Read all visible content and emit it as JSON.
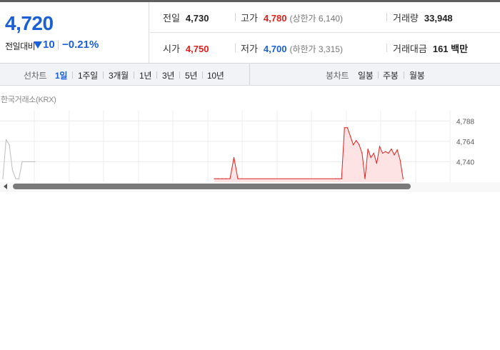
{
  "quote": {
    "price": "4,720",
    "change_label": "전일대비",
    "change_value": "10",
    "change_pct": "−0.21%",
    "direction": "down",
    "color_down": "#1a5fd6",
    "color_up": "#e0201d"
  },
  "stats": {
    "prev_close_label": "전일",
    "prev_close": "4,730",
    "high_label": "고가",
    "high": "4,780",
    "upper_limit": "(상한가 6,140)",
    "volume_label": "거래량",
    "volume": "33,948",
    "open_label": "시가",
    "open": "4,750",
    "low_label": "저가",
    "low": "4,700",
    "lower_limit": "(하한가 3,315)",
    "amount_label": "거래대금",
    "amount": "161 백만"
  },
  "range_bar": {
    "line_title": "선차트",
    "line_options": [
      "1일",
      "1주일",
      "3개월",
      "1년",
      "3년",
      "5년",
      "10년"
    ],
    "line_active": "1일",
    "candle_title": "봉차트",
    "candle_options": [
      "일봉",
      "주봉",
      "월봉"
    ]
  },
  "chart": {
    "exchange": "한국거래소(KRX)",
    "y_ticks": [
      "4,788",
      "4,764",
      "4,740"
    ],
    "series_color": "#e0201d",
    "fill_color": "#fde3e3",
    "grid_color": "#ececec"
  },
  "chart_data": {
    "type": "line",
    "ylabel": "",
    "ylim": [
      4716,
      4800
    ],
    "y_ticks": [
      4788,
      4764,
      4740
    ],
    "grid": true,
    "series": [
      {
        "values": [
          4720,
          4766,
          4760,
          4730,
          4720,
          4720,
          4740,
          4740,
          4740,
          4740,
          4740,
          4720,
          4720,
          4720,
          4720,
          4720,
          4745,
          4720,
          4720,
          4720,
          4720,
          4780,
          4780,
          4770,
          4760,
          4765,
          4760,
          4750,
          4720,
          4755,
          4745,
          4750,
          4738,
          4758,
          4750,
          4752,
          4750,
          4755,
          4748,
          4754,
          4742,
          4720
        ]
      }
    ]
  }
}
